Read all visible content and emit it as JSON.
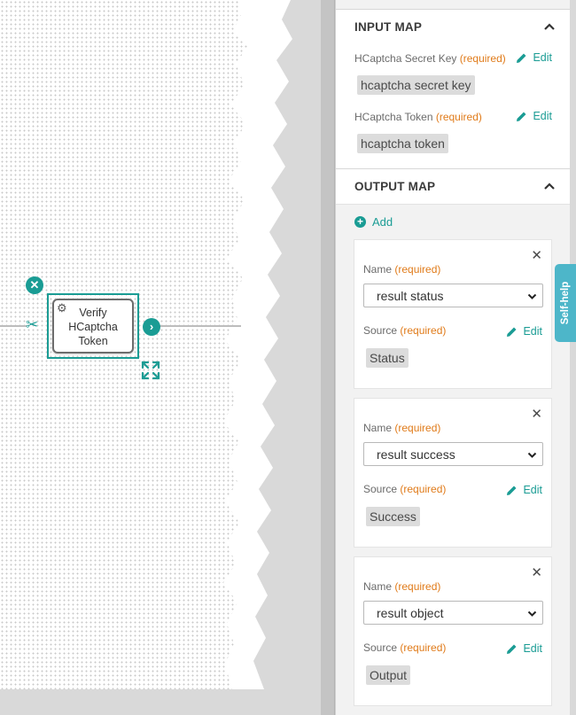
{
  "canvas": {
    "node": {
      "label": "Verify\nHCaptcha\nToken",
      "icon": "gear-icon"
    },
    "icons": {
      "delete": "close-circle-icon",
      "next": "chevron-right-circle-icon",
      "cut": "scissors-icon",
      "expand": "expand-icon"
    }
  },
  "input_map": {
    "title": "INPUT MAP",
    "fields": [
      {
        "label": "HCaptcha Secret Key",
        "required": "(required)",
        "edit": "Edit",
        "value": "hcaptcha secret key"
      },
      {
        "label": "HCaptcha Token",
        "required": "(required)",
        "edit": "Edit",
        "value": "hcaptcha token"
      }
    ]
  },
  "output_map": {
    "title": "OUTPUT MAP",
    "add_label": "Add",
    "items": [
      {
        "name_label": "Name",
        "required": "(required)",
        "name_value": "result status",
        "source_label": "Source",
        "edit": "Edit",
        "source_value": "Status"
      },
      {
        "name_label": "Name",
        "required": "(required)",
        "name_value": "result success",
        "source_label": "Source",
        "edit": "Edit",
        "source_value": "Success"
      },
      {
        "name_label": "Name",
        "required": "(required)",
        "name_value": "result object",
        "source_label": "Source",
        "edit": "Edit",
        "source_value": "Output"
      }
    ]
  },
  "self_help": {
    "label": "Self-help"
  },
  "colors": {
    "accent": "#1a9c94",
    "required": "#e07b1a",
    "self_help": "#4db6c9"
  }
}
